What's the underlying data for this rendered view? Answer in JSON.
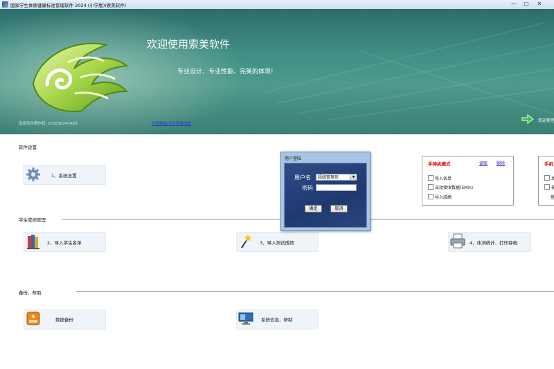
{
  "window": {
    "title": "国家学生体质健康标准管理软件 2024 (小学版)(索美软件)",
    "controls": {
      "minimize": "—",
      "maximize": "□",
      "close": "✕"
    }
  },
  "banner": {
    "welcome_title": "欢迎使用索美软件",
    "slogan": "专业设计、专业性能、完美的体现!",
    "copyright": "国家软件著作权: 2016SR243480",
    "link_text": "问题索赔/手机查看成绩",
    "welcome_button": "欢迎使用"
  },
  "sections": {
    "software_settings": {
      "title": "软件设置",
      "tiles": [
        {
          "label": "1、系统设置",
          "icon": "gear-icon"
        }
      ]
    },
    "grade_management": {
      "title": "学生成绩管理",
      "tiles": [
        {
          "label": "2、导入学生名单",
          "icon": "books-icon"
        },
        {
          "label": "3、导入测试成绩",
          "icon": "magic-wand-icon"
        },
        {
          "label": "4、体测统计、打印存档",
          "icon": "printer-icon"
        }
      ]
    },
    "backup_help": {
      "title": "备份、帮助",
      "tiles": [
        {
          "label": "数据备份",
          "icon": "backup-drive-icon"
        },
        {
          "label": "系统信息、帮助",
          "icon": "monitor-icon"
        }
      ]
    }
  },
  "handheld_panel": {
    "title": "手持机模式",
    "read_link": "读取",
    "delete_link": "删除",
    "options": [
      "导入名单",
      "自动接收数据(5Min)",
      "导入成绩"
    ]
  },
  "handheld_panel_2": {
    "title": "手机",
    "options": [
      "发",
      "获",
      "登"
    ]
  },
  "login_dialog": {
    "title": "用户登陆",
    "username_label": "用户名",
    "username_value": "超级管理员",
    "password_label": "密码",
    "password_value": "",
    "ok_button": "确定",
    "cancel_button": "取消"
  },
  "colors": {
    "banner": "#3f8e84",
    "panel_title": "#e00000",
    "link": "#1a1acc",
    "dialog_body": "#1f3970"
  }
}
